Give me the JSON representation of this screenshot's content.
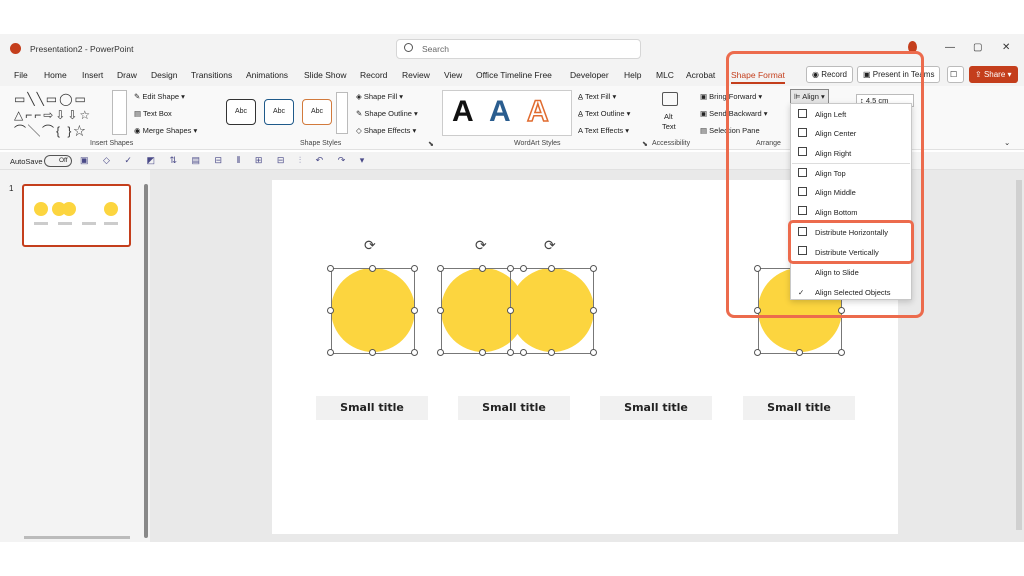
{
  "app": {
    "window_title": "Presentation2 - PowerPoint",
    "search_placeholder": "Search"
  },
  "menu_tabs": [
    "File",
    "Home",
    "Insert",
    "Draw",
    "Design",
    "Transitions",
    "Animations",
    "Slide Show",
    "Record",
    "Review",
    "View",
    "Office Timeline Free",
    "Developer",
    "Help",
    "MLC",
    "Acrobat",
    "Shape Format"
  ],
  "header_buttons": {
    "record": "Record",
    "present": "Present in Teams",
    "share": "Share"
  },
  "ribbon": {
    "insert_shapes": {
      "label": "Insert Shapes",
      "edit_shape": "Edit Shape",
      "text_box": "Text Box",
      "merge_shapes": "Merge Shapes"
    },
    "shape_styles": {
      "label": "Shape Styles",
      "samples": [
        "Abc",
        "Abc",
        "Abc"
      ],
      "fill": "Shape Fill",
      "outline": "Shape Outline",
      "effects": "Shape Effects"
    },
    "wordart_styles": {
      "label": "WordArt Styles",
      "samples": [
        "A",
        "A",
        "A"
      ],
      "text_fill": "Text Fill",
      "text_outline": "Text Outline",
      "text_effects": "Text Effects"
    },
    "accessibility": {
      "label": "Accessibility",
      "alt_text_1": "Alt",
      "alt_text_2": "Text"
    },
    "arrange": {
      "label": "Arrange",
      "bring_forward": "Bring Forward",
      "send_backward": "Send Backward",
      "selection_pane": "Selection Pane",
      "align": "Align"
    },
    "size": {
      "height": "4.5 cm"
    }
  },
  "qat": {
    "autosave": "AutoSave",
    "toggle": "Off"
  },
  "slide_panel": {
    "slide_number": "1"
  },
  "align_menu": {
    "items": [
      "Align Left",
      "Align Center",
      "Align Right",
      "Align Top",
      "Align Middle",
      "Align Bottom",
      "Distribute Horizontally",
      "Distribute Vertically",
      "Align to Slide",
      "Align Selected Objects"
    ],
    "checked": "Align Selected Objects"
  },
  "slide": {
    "titles": [
      "Small title",
      "Small title",
      "Small title",
      "Small title"
    ]
  },
  "colors": {
    "accent": "#c43e1c",
    "circle": "#fcd53f",
    "highlight": "#ec6b4d"
  }
}
